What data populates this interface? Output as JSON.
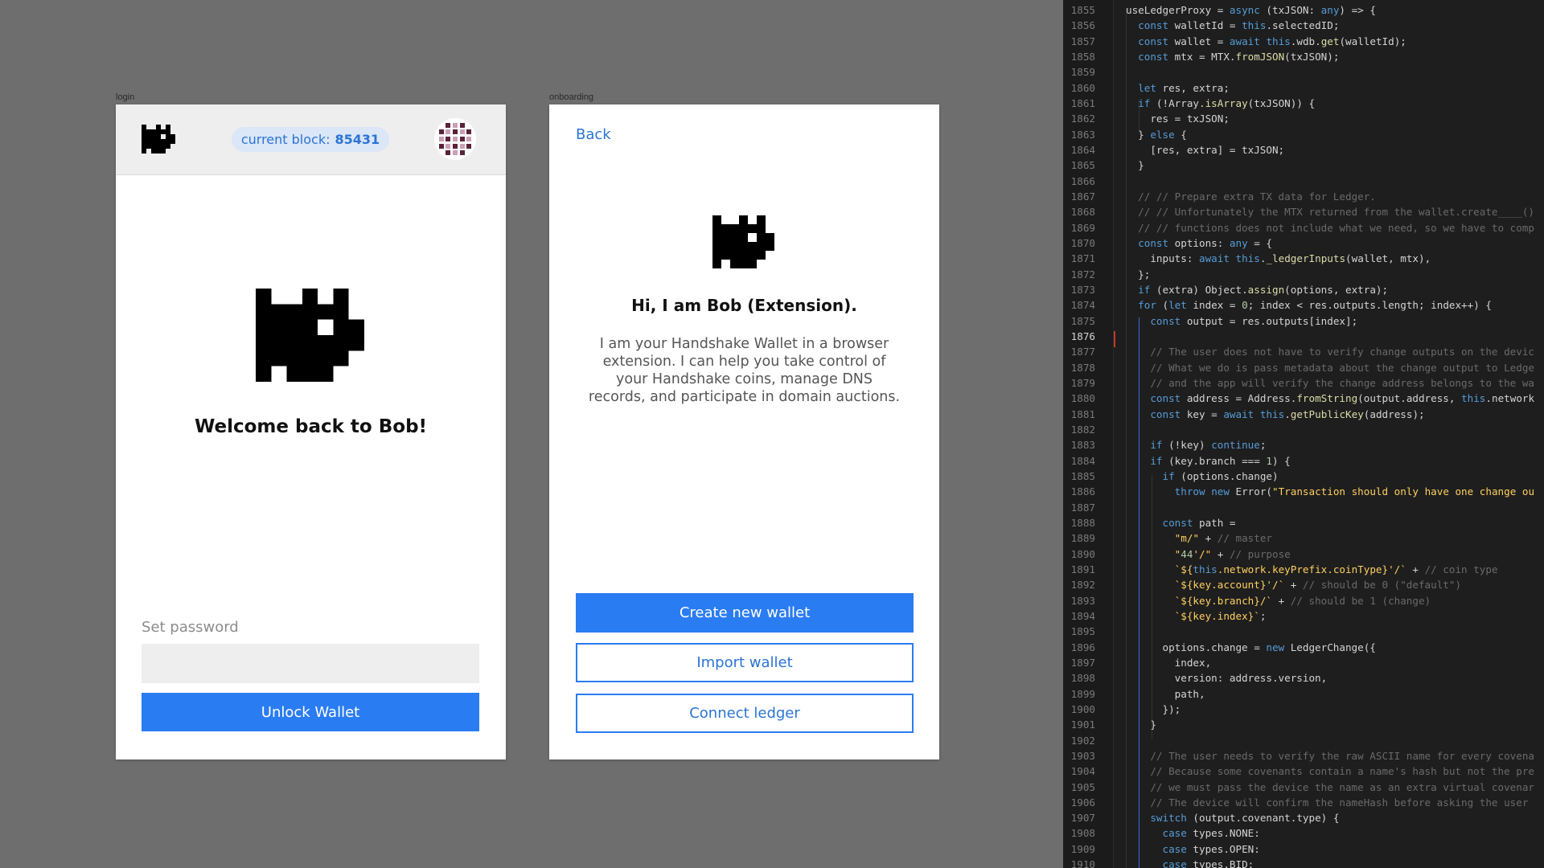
{
  "frames": {
    "login_label": "login",
    "onboarding_label": "onboarding"
  },
  "login": {
    "block_label": "current block:",
    "block_number": "85431",
    "welcome": "Welcome back to Bob!",
    "password_label": "Set password",
    "password_value": "",
    "unlock_label": "Unlock Wallet"
  },
  "onboarding": {
    "back_label": "Back",
    "greeting": "Hi, I am Bob (Extension).",
    "description": "I am your Handshake Wallet in a browser extension. I can help you take control of your Handshake coins, manage DNS records, and participate in domain auctions.",
    "create_label": "Create new wallet",
    "import_label": "Import wallet",
    "ledger_label": "Connect ledger"
  },
  "colors": {
    "accent": "#2a7cf2",
    "pill_bg": "#dbe6f7",
    "canvas": "#6e6e6e",
    "editor_bg": "#1e1e1e"
  },
  "icons": {
    "logo": "bob-pixel-cat-logo",
    "avatar": "identicon-avatar"
  },
  "editor": {
    "current_line": "1876",
    "lines": [
      {
        "n": "1855",
        "t": "useLedgerProxy = async (txJSON: any) => {"
      },
      {
        "n": "1856",
        "t": "  const walletId = this.selectedID;"
      },
      {
        "n": "1857",
        "t": "  const wallet = await this.wdb.get(walletId);"
      },
      {
        "n": "1858",
        "t": "  const mtx = MTX.fromJSON(txJSON);"
      },
      {
        "n": "1859",
        "t": ""
      },
      {
        "n": "1860",
        "t": "  let res, extra;"
      },
      {
        "n": "1861",
        "t": "  if (!Array.isArray(txJSON)) {"
      },
      {
        "n": "1862",
        "t": "    res = txJSON;"
      },
      {
        "n": "1863",
        "t": "  } else {"
      },
      {
        "n": "1864",
        "t": "    [res, extra] = txJSON;"
      },
      {
        "n": "1865",
        "t": "  }"
      },
      {
        "n": "1866",
        "t": ""
      },
      {
        "n": "1867",
        "t": "  // // Prepare extra TX data for Ledger."
      },
      {
        "n": "1868",
        "t": "  // // Unfortunately the MTX returned from the wallet.create____()"
      },
      {
        "n": "1869",
        "t": "  // // functions does not include what we need, so we have to comp"
      },
      {
        "n": "1870",
        "t": "  const options: any = {"
      },
      {
        "n": "1871",
        "t": "    inputs: await this._ledgerInputs(wallet, mtx),"
      },
      {
        "n": "1872",
        "t": "  };"
      },
      {
        "n": "1873",
        "t": "  if (extra) Object.assign(options, extra);"
      },
      {
        "n": "1874",
        "t": "  for (let index = 0; index < res.outputs.length; index++) {"
      },
      {
        "n": "1875",
        "t": "    const output = res.outputs[index];"
      },
      {
        "n": "1876",
        "t": ""
      },
      {
        "n": "1877",
        "t": "    // The user does not have to verify change outputs on the devic"
      },
      {
        "n": "1878",
        "t": "    // What we do is pass metadata about the change output to Ledge"
      },
      {
        "n": "1879",
        "t": "    // and the app will verify the change address belongs to the wa"
      },
      {
        "n": "1880",
        "t": "    const address = Address.fromString(output.address, this.network"
      },
      {
        "n": "1881",
        "t": "    const key = await this.getPublicKey(address);"
      },
      {
        "n": "1882",
        "t": ""
      },
      {
        "n": "1883",
        "t": "    if (!key) continue;"
      },
      {
        "n": "1884",
        "t": "    if (key.branch === 1) {"
      },
      {
        "n": "1885",
        "t": "      if (options.change)"
      },
      {
        "n": "1886",
        "t": "        throw new Error(\"Transaction should only have one change ou"
      },
      {
        "n": "1887",
        "t": ""
      },
      {
        "n": "1888",
        "t": "      const path ="
      },
      {
        "n": "1889",
        "t": "        \"m/\" + // master"
      },
      {
        "n": "1890",
        "t": "        \"44'/\" + // purpose"
      },
      {
        "n": "1891",
        "t": "        `${this.network.keyPrefix.coinType}'/` + // coin type"
      },
      {
        "n": "1892",
        "t": "        `${key.account}'/` + // should be 0 (\"default\")"
      },
      {
        "n": "1893",
        "t": "        `${key.branch}/` + // should be 1 (change)"
      },
      {
        "n": "1894",
        "t": "        `${key.index}`;"
      },
      {
        "n": "1895",
        "t": ""
      },
      {
        "n": "1896",
        "t": "      options.change = new LedgerChange({"
      },
      {
        "n": "1897",
        "t": "        index,"
      },
      {
        "n": "1898",
        "t": "        version: address.version,"
      },
      {
        "n": "1899",
        "t": "        path,"
      },
      {
        "n": "1900",
        "t": "      });"
      },
      {
        "n": "1901",
        "t": "    }"
      },
      {
        "n": "1902",
        "t": ""
      },
      {
        "n": "1903",
        "t": "    // The user needs to verify the raw ASCII name for every covena"
      },
      {
        "n": "1904",
        "t": "    // Because some covenants contain a name's hash but not the pre"
      },
      {
        "n": "1905",
        "t": "    // we must pass the device the name as an extra virtual covenar"
      },
      {
        "n": "1906",
        "t": "    // The device will confirm the nameHash before asking the user"
      },
      {
        "n": "1907",
        "t": "    switch (output.covenant.type) {"
      },
      {
        "n": "1908",
        "t": "      case types.NONE:"
      },
      {
        "n": "1909",
        "t": "      case types.OPEN:"
      },
      {
        "n": "1910",
        "t": "      case types.BID:"
      }
    ]
  }
}
